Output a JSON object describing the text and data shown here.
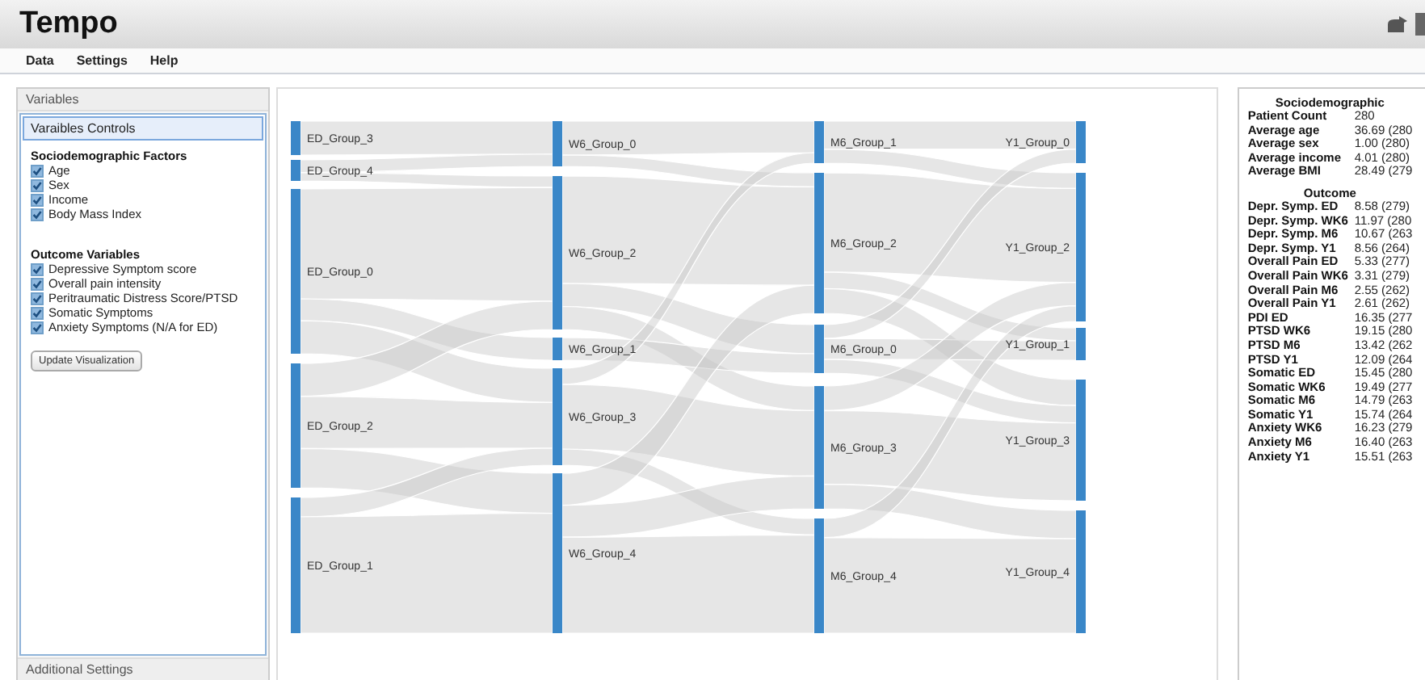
{
  "app": {
    "title": "Tempo"
  },
  "menu": [
    "Data",
    "Settings",
    "Help"
  ],
  "left_panel": {
    "title": "Variables",
    "controls_title": "Varaibles Controls",
    "groups": [
      {
        "title": "Sociodemographic Factors",
        "items": [
          {
            "label": "Age",
            "checked": true
          },
          {
            "label": "Sex",
            "checked": true
          },
          {
            "label": "Income",
            "checked": true
          },
          {
            "label": "Body Mass Index",
            "checked": true
          }
        ]
      },
      {
        "title": "Outcome Variables",
        "items": [
          {
            "label": "Depressive Symptom score",
            "checked": true
          },
          {
            "label": "Overall pain intensity",
            "checked": true
          },
          {
            "label": "Peritraumatic Distress Score/PTSD",
            "checked": true
          },
          {
            "label": "Somatic Symptoms",
            "checked": true
          },
          {
            "label": "Anxiety Symptoms (N/A for ED)",
            "checked": true
          }
        ]
      }
    ],
    "button": "Update Visualization",
    "footer": "Additional Settings"
  },
  "sankey": {
    "columns": [
      [
        "ED_Group_3",
        "ED_Group_4",
        "ED_Group_0",
        "ED_Group_2",
        "ED_Group_1"
      ],
      [
        "W6_Group_0",
        "W6_Group_2",
        "W6_Group_1",
        "W6_Group_3",
        "W6_Group_4"
      ],
      [
        "M6_Group_1",
        "M6_Group_2",
        "M6_Group_0",
        "M6_Group_3",
        "M6_Group_4"
      ],
      [
        "Y1_Group_0",
        "Y1_Group_2",
        "Y1_Group_1",
        "Y1_Group_3",
        "Y1_Group_4"
      ]
    ]
  },
  "stats": {
    "sections": [
      {
        "title": "Sociodemographic",
        "rows": [
          {
            "label": "Patient Count",
            "value": "280"
          },
          {
            "label": "Average age",
            "value": "36.69 (280"
          },
          {
            "label": "Average sex",
            "value": "1.00 (280)"
          },
          {
            "label": "Average income",
            "value": "4.01 (280)"
          },
          {
            "label": "Average BMI",
            "value": "28.49 (279"
          }
        ]
      },
      {
        "title": "Outcome",
        "rows": [
          {
            "label": "Depr. Symp. ED",
            "value": "8.58 (279)"
          },
          {
            "label": "Depr. Symp. WK6",
            "value": "11.97 (280"
          },
          {
            "label": "Depr. Symp. M6",
            "value": "10.67 (263"
          },
          {
            "label": "Depr. Symp. Y1",
            "value": "8.56 (264)"
          },
          {
            "label": "Overall Pain ED",
            "value": "5.33 (277)"
          },
          {
            "label": "Overall Pain WK6",
            "value": "3.31 (279)"
          },
          {
            "label": "Overall Pain M6",
            "value": "2.55 (262)"
          },
          {
            "label": "Overall Pain Y1",
            "value": "2.61 (262)"
          },
          {
            "label": "PDI ED",
            "value": "16.35 (277"
          },
          {
            "label": "PTSD WK6",
            "value": "19.15 (280"
          },
          {
            "label": "PTSD M6",
            "value": "13.42 (262"
          },
          {
            "label": "PTSD Y1",
            "value": "12.09 (264"
          },
          {
            "label": "Somatic ED",
            "value": "15.45 (280"
          },
          {
            "label": "Somatic WK6",
            "value": "19.49 (277"
          },
          {
            "label": "Somatic M6",
            "value": "14.79 (263"
          },
          {
            "label": "Somatic Y1",
            "value": "15.74 (264"
          },
          {
            "label": "Anxiety WK6",
            "value": "16.23 (279"
          },
          {
            "label": "Anxiety M6",
            "value": "16.40 (263"
          },
          {
            "label": "Anxiety Y1",
            "value": "15.51 (263"
          }
        ]
      }
    ]
  }
}
